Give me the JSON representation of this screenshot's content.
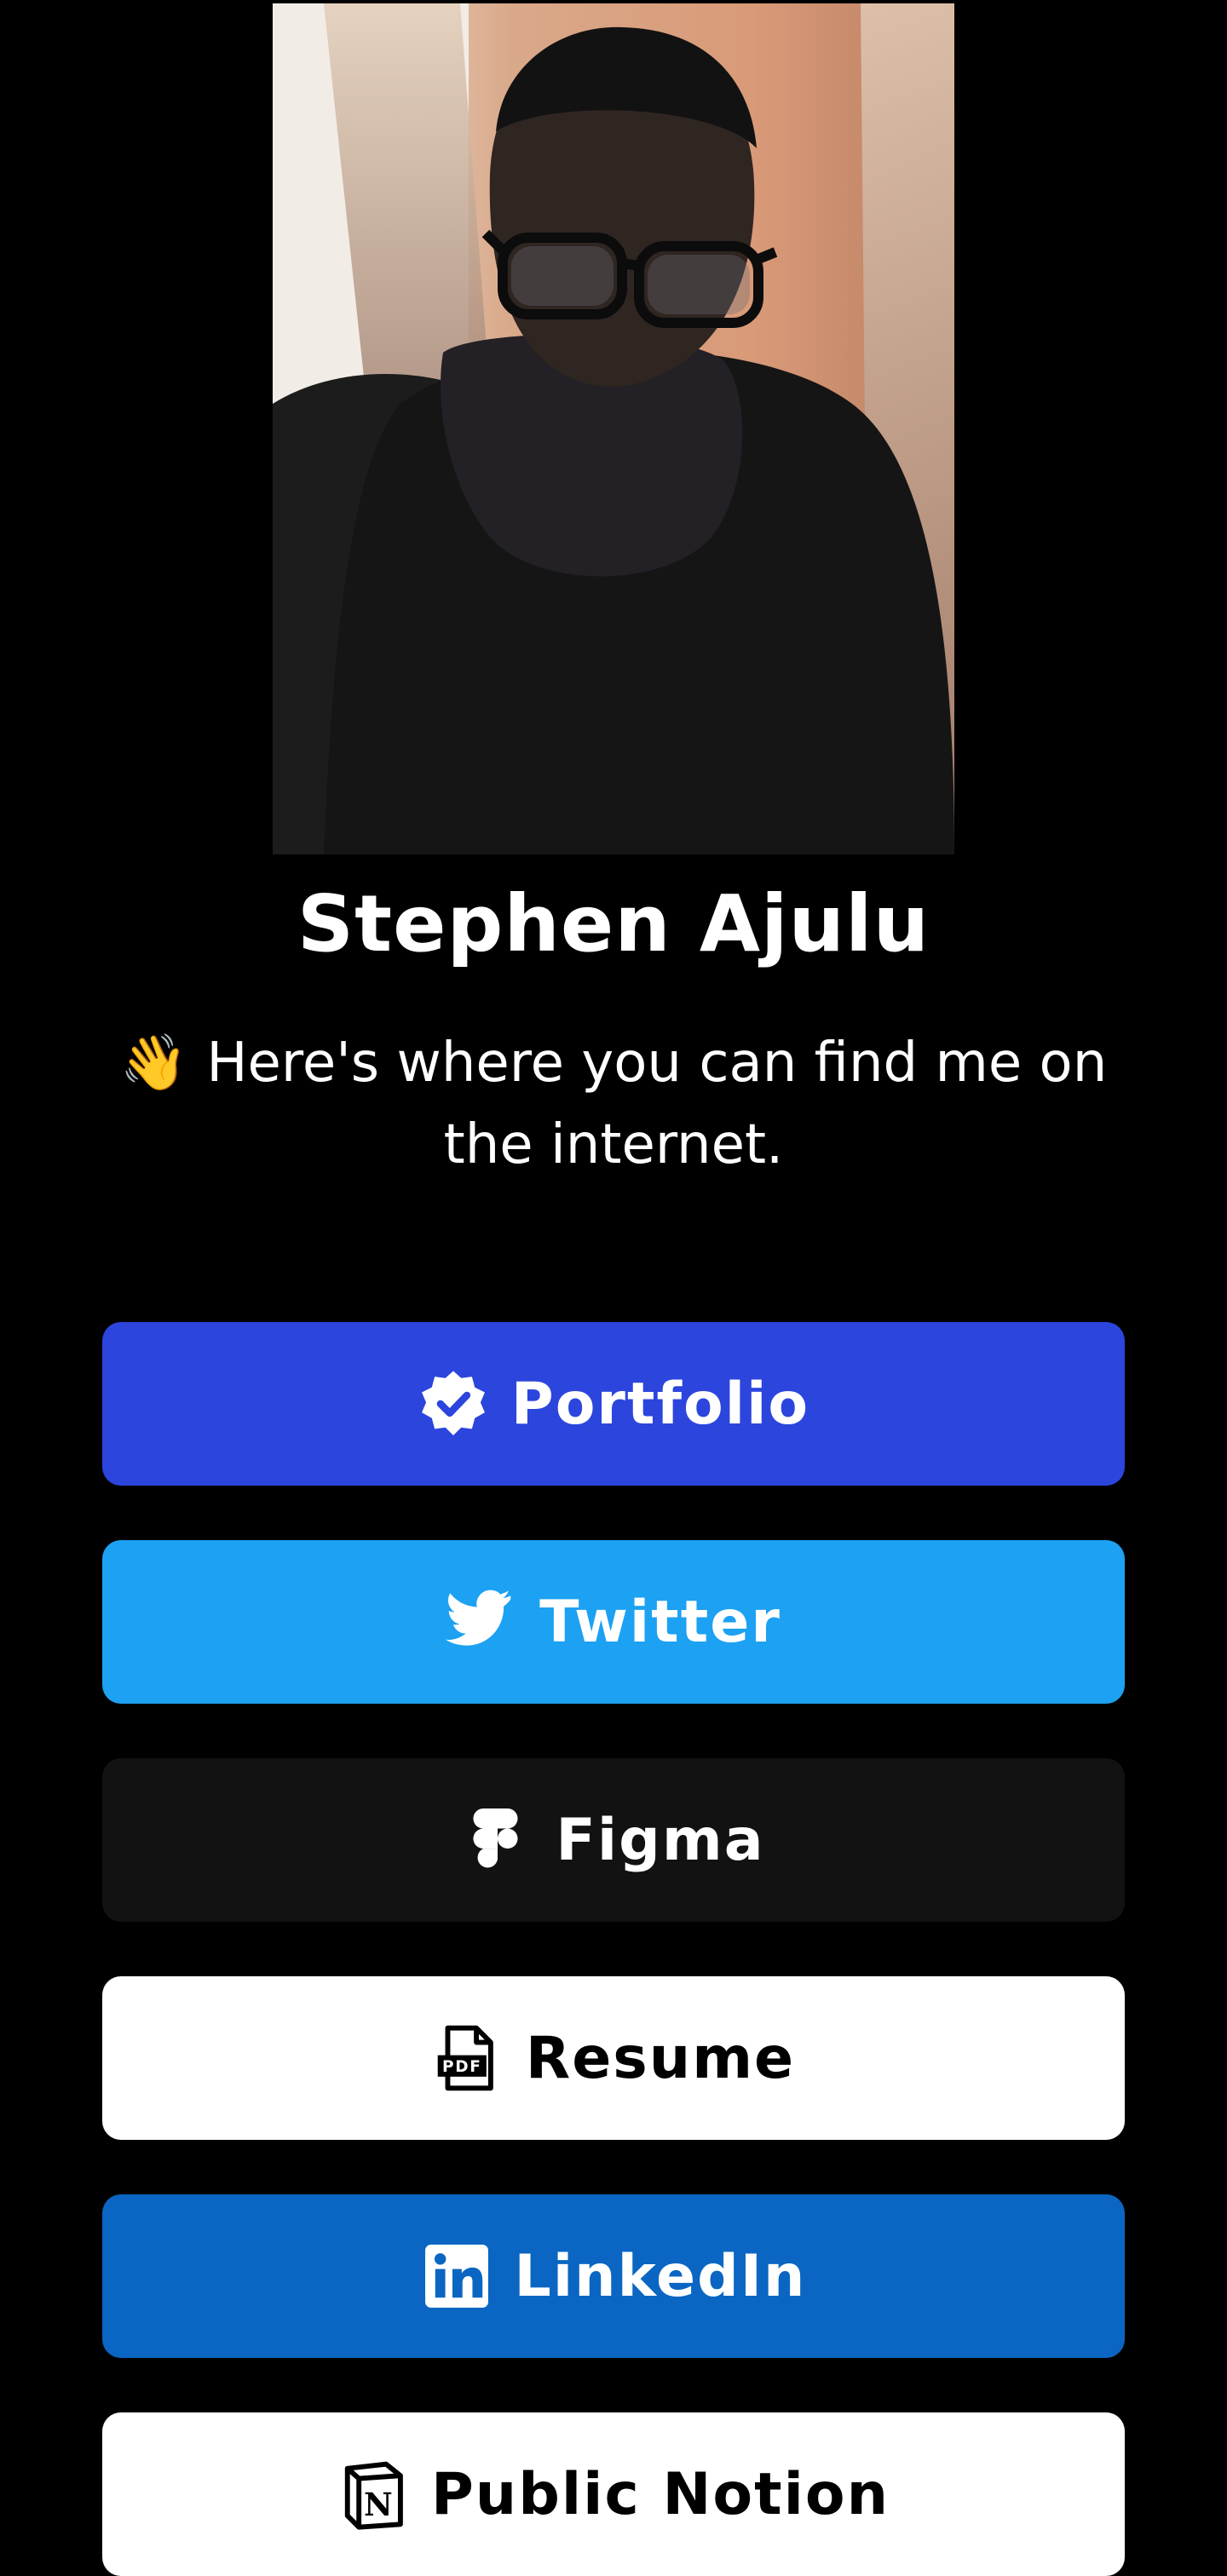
{
  "profile": {
    "name": "Stephen Ajulu",
    "tagline_emoji": "👋",
    "tagline": "Here's where you can find me on the internet.",
    "photo_icon": "profile-photo"
  },
  "links": [
    {
      "label": "Portfolio",
      "icon": "verified-badge-icon",
      "bg": "#2c45dd",
      "fg": "#ffffff"
    },
    {
      "label": "Twitter",
      "icon": "twitter-icon",
      "bg": "#1da1f2",
      "fg": "#ffffff"
    },
    {
      "label": "Figma",
      "icon": "figma-icon",
      "bg": "#121212",
      "fg": "#ffffff"
    },
    {
      "label": "Resume",
      "icon": "pdf-file-icon",
      "bg": "#ffffff",
      "fg": "#000000"
    },
    {
      "label": "LinkedIn",
      "icon": "linkedin-icon",
      "bg": "#0a66c2",
      "fg": "#ffffff"
    },
    {
      "label": "Public Notion",
      "icon": "notion-icon",
      "bg": "#ffffff",
      "fg": "#000000"
    }
  ]
}
